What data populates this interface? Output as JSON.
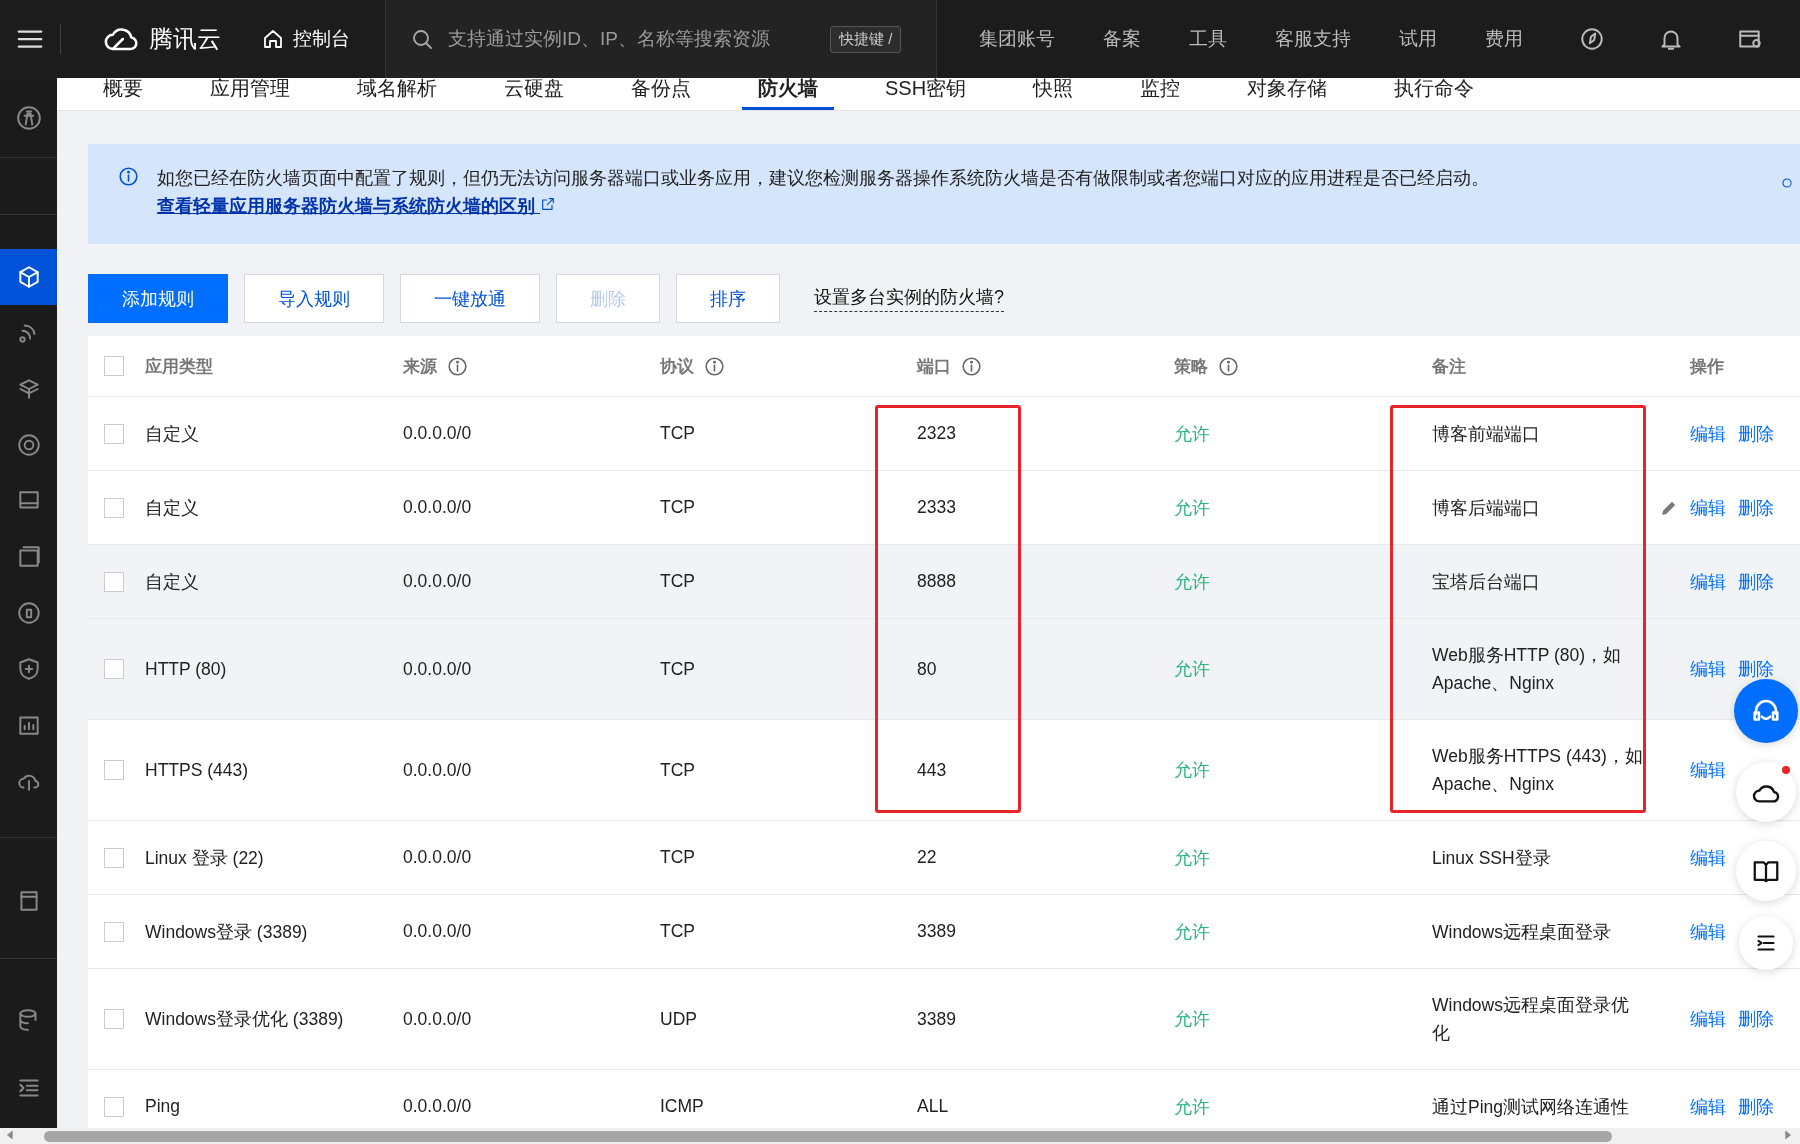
{
  "topbar": {
    "brand": "腾讯云",
    "console": "控制台",
    "search": {
      "placeholder": "支持通过实例ID、IP、名称等搜索资源"
    },
    "shortcut": "快捷键 /",
    "nav": [
      "集团账号",
      "备案",
      "工具",
      "客服支持",
      "试用",
      "费用"
    ]
  },
  "tabs": [
    {
      "label": "概要",
      "selected": false
    },
    {
      "label": "应用管理",
      "selected": false
    },
    {
      "label": "域名解析",
      "selected": false
    },
    {
      "label": "云硬盘",
      "selected": false
    },
    {
      "label": "备份点",
      "selected": false
    },
    {
      "label": "防火墙",
      "selected": true
    },
    {
      "label": "SSH密钥",
      "selected": false
    },
    {
      "label": "快照",
      "selected": false
    },
    {
      "label": "监控",
      "selected": false
    },
    {
      "label": "对象存储",
      "selected": false
    },
    {
      "label": "执行命令",
      "selected": false
    }
  ],
  "notice": {
    "text": "如您已经在防火墙页面中配置了规则，但仍无法访问服务器端口或业务应用，建议您检测服务器操作系统防火墙是否有做限制或者您端口对应的应用进程是否已经启动。",
    "link": "查看轻量应用服务器防火墙与系统防火墙的区别"
  },
  "toolbar": {
    "buttons": [
      {
        "label": "添加规则",
        "kind": "primary",
        "disabled": false
      },
      {
        "label": "导入规则",
        "kind": "default",
        "disabled": false
      },
      {
        "label": "一键放通",
        "kind": "default",
        "disabled": false
      },
      {
        "label": "删除",
        "kind": "default",
        "disabled": true
      },
      {
        "label": "排序",
        "kind": "default",
        "disabled": false
      }
    ],
    "help": "设置多台实例的防火墙?"
  },
  "table": {
    "select_all_checked": false,
    "columns": [
      {
        "label": "应用类型",
        "info": false
      },
      {
        "label": "来源",
        "info": true
      },
      {
        "label": "协议",
        "info": true
      },
      {
        "label": "端口",
        "info": true
      },
      {
        "label": "策略",
        "info": true
      },
      {
        "label": "备注",
        "info": false
      },
      {
        "label": "操作",
        "info": false
      }
    ],
    "rows": [
      {
        "checked": false,
        "shaded": false,
        "type": "自定义",
        "source": "0.0.0.0/0",
        "protocol": "TCP",
        "port": "2323",
        "policy": "允许",
        "note": "博客前端端口",
        "note_edit": false,
        "port_marked": true,
        "note_marked": true,
        "actions": [
          "编辑",
          "删除"
        ]
      },
      {
        "checked": false,
        "shaded": false,
        "type": "自定义",
        "source": "0.0.0.0/0",
        "protocol": "TCP",
        "port": "2333",
        "policy": "允许",
        "note": "博客后端端口",
        "note_edit": true,
        "port_marked": true,
        "note_marked": true,
        "actions": [
          "编辑",
          "删除"
        ]
      },
      {
        "checked": false,
        "shaded": true,
        "type": "自定义",
        "source": "0.0.0.0/0",
        "protocol": "TCP",
        "port": "8888",
        "policy": "允许",
        "note": "宝塔后台端口",
        "note_edit": false,
        "port_marked": true,
        "note_marked": true,
        "actions": [
          "编辑",
          "删除"
        ]
      },
      {
        "checked": false,
        "shaded": true,
        "type": "HTTP (80)",
        "source": "0.0.0.0/0",
        "protocol": "TCP",
        "port": "80",
        "policy": "允许",
        "note": "Web服务HTTP (80)，如Apache、Nginx",
        "note_edit": false,
        "port_marked": true,
        "note_marked": true,
        "actions": [
          "编辑",
          "删除"
        ]
      },
      {
        "checked": false,
        "shaded": false,
        "type": "HTTPS (443)",
        "source": "0.0.0.0/0",
        "protocol": "TCP",
        "port": "443",
        "policy": "允许",
        "note": "Web服务HTTPS (443)，如Apache、Nginx",
        "note_edit": false,
        "port_marked": true,
        "note_marked": true,
        "actions": [
          "编辑"
        ]
      },
      {
        "checked": false,
        "shaded": false,
        "type": "Linux 登录 (22)",
        "source": "0.0.0.0/0",
        "protocol": "TCP",
        "port": "22",
        "policy": "允许",
        "note": "Linux SSH登录",
        "note_edit": false,
        "port_marked": false,
        "note_marked": false,
        "actions": [
          "编辑"
        ]
      },
      {
        "checked": false,
        "shaded": false,
        "type": "Windows登录 (3389)",
        "source": "0.0.0.0/0",
        "protocol": "TCP",
        "port": "3389",
        "policy": "允许",
        "note": "Windows远程桌面登录",
        "note_edit": false,
        "port_marked": false,
        "note_marked": false,
        "actions": [
          "编辑"
        ]
      },
      {
        "checked": false,
        "shaded": false,
        "type": "Windows登录优化 (3389)",
        "source": "0.0.0.0/0",
        "protocol": "UDP",
        "port": "3389",
        "policy": "允许",
        "note": "Windows远程桌面登录优化",
        "note_edit": false,
        "port_marked": false,
        "note_marked": false,
        "actions": [
          "编辑",
          "删除"
        ]
      },
      {
        "checked": false,
        "shaded": false,
        "type": "Ping",
        "source": "0.0.0.0/0",
        "protocol": "ICMP",
        "port": "ALL",
        "policy": "允许",
        "note": "通过Ping测试网络连通性",
        "note_edit": false,
        "port_marked": false,
        "note_marked": false,
        "actions": [
          "编辑",
          "删除"
        ]
      }
    ]
  }
}
